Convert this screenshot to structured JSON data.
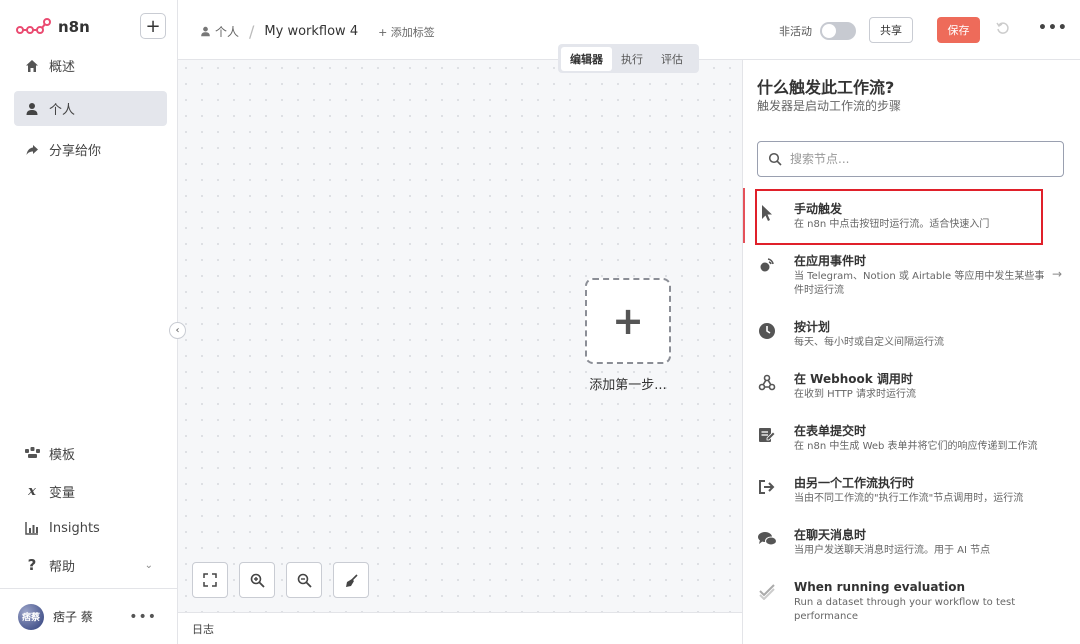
{
  "app": {
    "name": "n8n"
  },
  "sidebar": {
    "items": [
      {
        "label": "概述",
        "icon": "home-icon",
        "active": false
      },
      {
        "label": "个人",
        "icon": "user-icon",
        "active": true
      },
      {
        "label": "分享给你",
        "icon": "share-icon",
        "active": false
      }
    ],
    "bottom_items": [
      {
        "label": "模板",
        "icon": "templates-icon"
      },
      {
        "label": "变量",
        "icon": "variables-icon"
      },
      {
        "label": "Insights",
        "icon": "insights-icon"
      },
      {
        "label": "帮助",
        "icon": "help-icon"
      }
    ],
    "user": {
      "name": "痞子 蔡",
      "avatar_text": "痞蔡"
    }
  },
  "header": {
    "breadcrumb_owner": "个人",
    "workflow_name": "My workflow 4",
    "add_tag": "+ 添加标签",
    "status_label": "非活动",
    "share_label": "共享",
    "save_label": "保存"
  },
  "canvas": {
    "tabs": [
      {
        "label": "编辑器",
        "active": true
      },
      {
        "label": "执行",
        "active": false
      },
      {
        "label": "评估",
        "active": false
      }
    ],
    "add_first_step": "添加第一步...",
    "log_label": "日志"
  },
  "panel": {
    "title": "什么触发此工作流?",
    "subtitle": "触发器是启动工作流的步骤",
    "search_placeholder": "搜索节点...",
    "nodes": [
      {
        "name": "手动触发",
        "desc": "在 n8n 中点击按钮时运行流。适合快速入门",
        "icon": "cursor-icon"
      },
      {
        "name": "在应用事件时",
        "desc": "当 Telegram、Notion 或 Airtable 等应用中发生某些事件时运行流",
        "icon": "app-event-icon"
      },
      {
        "name": "按计划",
        "desc": "每天、每小时或自定义间隔运行流",
        "icon": "clock-icon"
      },
      {
        "name": "在 Webhook 调用时",
        "desc": "在收到 HTTP 请求时运行流",
        "icon": "webhook-icon"
      },
      {
        "name": "在表单提交时",
        "desc": "在 n8n 中生成 Web 表单并将它们的响应传递到工作流",
        "icon": "form-icon"
      },
      {
        "name": "由另一个工作流执行时",
        "desc": "当由不同工作流的\"执行工作流\"节点调用时，运行流",
        "icon": "sub-workflow-icon"
      },
      {
        "name": "在聊天消息时",
        "desc": "当用户发送聊天消息时运行流。用于 AI 节点",
        "icon": "chat-icon"
      },
      {
        "name": "When running evaluation",
        "desc": "Run a dataset through your workflow to test performance",
        "icon": "evaluation-icon"
      }
    ]
  },
  "colors": {
    "accent": "#ee6b5a",
    "highlight": "#e0202a"
  }
}
